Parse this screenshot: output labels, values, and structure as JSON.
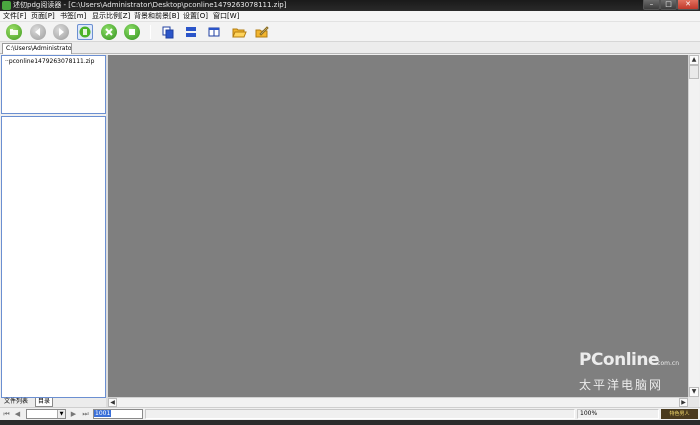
{
  "window": {
    "title": "述仞pdg阅读器 - [C:\\Users\\Administrator\\Desktop\\pconline1479263078111.zip]",
    "minimize_label": "–",
    "maximize_label": "□",
    "close_label": "✕"
  },
  "menu": [
    {
      "label": "文件[F]"
    },
    {
      "label": "页面[P]"
    },
    {
      "label": "书签[m]"
    },
    {
      "label": "显示比例[Z]"
    },
    {
      "label": "背景和前景[B]"
    },
    {
      "label": "设置[O]"
    },
    {
      "label": "窗口[W]"
    }
  ],
  "toolbar": {
    "icons": [
      "open-icon",
      "back-icon",
      "forward-icon",
      "bookmark-icon",
      "close-doc-icon",
      "stop-icon",
      "single-page-icon",
      "continuous-page-icon",
      "double-page-icon",
      "open-folder-icon",
      "edit-icon"
    ]
  },
  "tab": {
    "path": "C:\\Users\\Administrator\\D"
  },
  "file_list": {
    "items": [
      "pconline1479263078111.zip"
    ]
  },
  "pane_tabs": {
    "file_list": "文件列表",
    "toc": "目录"
  },
  "status": {
    "page_value": "1001",
    "zoom": "100%",
    "badge": "特色男人"
  },
  "watermark": {
    "logo": "PConline",
    "domain": ".com.cn",
    "subtitle": "太平洋电脑网"
  },
  "colors": {
    "view_background": "#7f7f7f",
    "selection": "#3a6fd8"
  }
}
